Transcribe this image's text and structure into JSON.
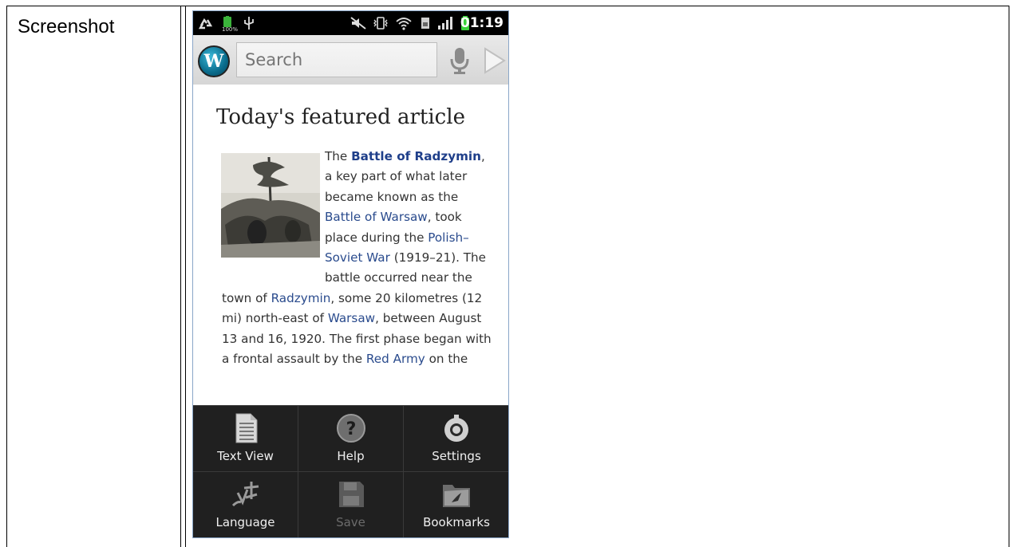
{
  "doc": {
    "label": "Screenshot"
  },
  "status_bar": {
    "time": "01:19",
    "icons": [
      "recycle-icon",
      "battery-100-icon",
      "usb-icon",
      "mute-icon",
      "vibrate-icon",
      "wifi-icon",
      "sim-icon",
      "signal-icon",
      "battery-icon"
    ],
    "battery_badge": "100%"
  },
  "search": {
    "placeholder": "Search",
    "logo_letter": "W"
  },
  "article": {
    "heading": "Today's featured article",
    "p": [
      {
        "t": "The ",
        "k": "text"
      },
      {
        "t": "Battle of Radzymin",
        "k": "bold"
      },
      {
        "t": ", a key part of what later became known as the ",
        "k": "text"
      },
      {
        "t": "Battle of Warsaw",
        "k": "link"
      },
      {
        "t": ", took place during the ",
        "k": "text"
      },
      {
        "t": "Polish–Soviet War",
        "k": "link"
      },
      {
        "t": " (1919–21). The battle occurred near the town of ",
        "k": "text"
      },
      {
        "t": "Radzymin",
        "k": "link"
      },
      {
        "t": ", some 20 kilometres (12 mi) north-east of ",
        "k": "text"
      },
      {
        "t": "Warsaw",
        "k": "link"
      },
      {
        "t": ", between August 13 and 16, 1920. The first phase began with a frontal assault by the ",
        "k": "text"
      },
      {
        "t": "Red Army",
        "k": "link"
      },
      {
        "t": " on the",
        "k": "text"
      }
    ]
  },
  "menu": {
    "items": [
      {
        "label": "Text View",
        "icon": "document-icon",
        "enabled": true
      },
      {
        "label": "Help",
        "icon": "help-icon",
        "enabled": true
      },
      {
        "label": "Settings",
        "icon": "settings-icon",
        "enabled": true
      },
      {
        "label": "Language",
        "icon": "language-icon",
        "enabled": true
      },
      {
        "label": "Save",
        "icon": "save-icon",
        "enabled": false
      },
      {
        "label": "Bookmarks",
        "icon": "bookmarks-icon",
        "enabled": true
      }
    ]
  },
  "colors": {
    "link": "#2a4b8d",
    "menu_bg": "#202020",
    "status_bg": "#000000"
  }
}
